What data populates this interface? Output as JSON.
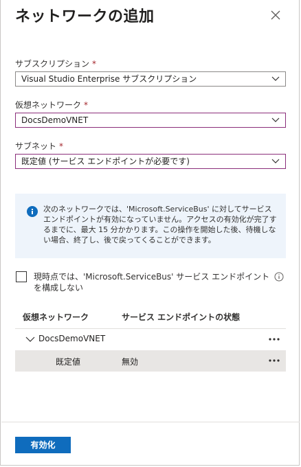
{
  "panel": {
    "title": "ネットワークの追加"
  },
  "subscription": {
    "label": "サブスクリプション",
    "required_mark": "*",
    "value": "Visual Studio Enterprise サブスクリプション"
  },
  "vnet": {
    "label": "仮想ネットワーク",
    "required_mark": "*",
    "value": "DocsDemoVNET"
  },
  "subnet": {
    "label": "サブネット",
    "required_mark": "*",
    "value": "既定値 (サービス エンドポイントが必要です)"
  },
  "info": {
    "message": "次のネットワークでは、'Microsoft.ServiceBus' に対してサービス エンドポイントが有効になっていません。アクセスの有効化が完了するまでに、最大 15 分かかります。この操作を開始した後、待機しない場合、終了し、後で戻ってくることができます。"
  },
  "skip_endpoint": {
    "label": "現時点では、'Microsoft.ServiceBus' サービス エンドポイントを構成しない",
    "checked": false
  },
  "table": {
    "headers": [
      "仮想ネットワーク",
      "サービス エンドポイントの状態"
    ],
    "vnet_row": {
      "name": "DocsDemoVNET"
    },
    "subnet_row": {
      "name": "既定値",
      "status": "無効"
    }
  },
  "footer": {
    "enable_label": "有効化"
  },
  "colors": {
    "accent": "#0f6cbd",
    "required": "#a4262c",
    "highlight_border": "#8a2d7a",
    "info_bg": "#eef4fb"
  }
}
